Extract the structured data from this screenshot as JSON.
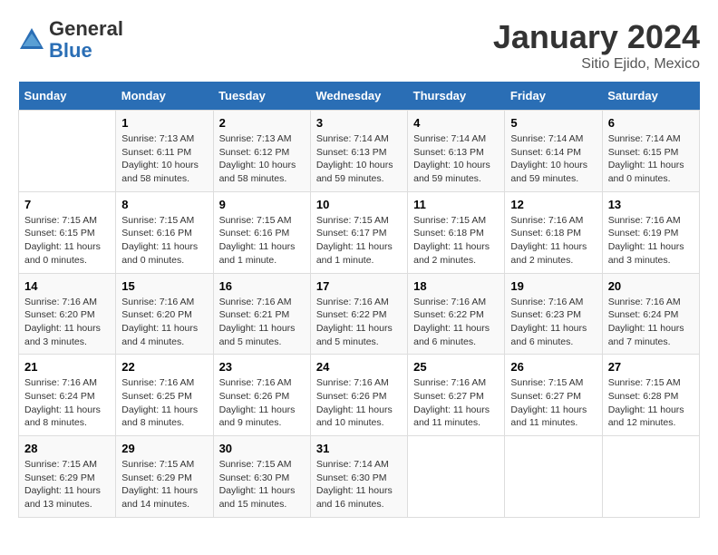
{
  "logo": {
    "general": "General",
    "blue": "Blue"
  },
  "title": "January 2024",
  "location": "Sitio Ejido, Mexico",
  "weekdays": [
    "Sunday",
    "Monday",
    "Tuesday",
    "Wednesday",
    "Thursday",
    "Friday",
    "Saturday"
  ],
  "weeks": [
    [
      {
        "day": "",
        "sunrise": "",
        "sunset": "",
        "daylight": ""
      },
      {
        "day": "1",
        "sunrise": "7:13 AM",
        "sunset": "6:11 PM",
        "daylight": "10 hours and 58 minutes."
      },
      {
        "day": "2",
        "sunrise": "7:13 AM",
        "sunset": "6:12 PM",
        "daylight": "10 hours and 58 minutes."
      },
      {
        "day": "3",
        "sunrise": "7:14 AM",
        "sunset": "6:13 PM",
        "daylight": "10 hours and 59 minutes."
      },
      {
        "day": "4",
        "sunrise": "7:14 AM",
        "sunset": "6:13 PM",
        "daylight": "10 hours and 59 minutes."
      },
      {
        "day": "5",
        "sunrise": "7:14 AM",
        "sunset": "6:14 PM",
        "daylight": "10 hours and 59 minutes."
      },
      {
        "day": "6",
        "sunrise": "7:14 AM",
        "sunset": "6:15 PM",
        "daylight": "11 hours and 0 minutes."
      }
    ],
    [
      {
        "day": "7",
        "sunrise": "7:15 AM",
        "sunset": "6:15 PM",
        "daylight": "11 hours and 0 minutes."
      },
      {
        "day": "8",
        "sunrise": "7:15 AM",
        "sunset": "6:16 PM",
        "daylight": "11 hours and 0 minutes."
      },
      {
        "day": "9",
        "sunrise": "7:15 AM",
        "sunset": "6:16 PM",
        "daylight": "11 hours and 1 minute."
      },
      {
        "day": "10",
        "sunrise": "7:15 AM",
        "sunset": "6:17 PM",
        "daylight": "11 hours and 1 minute."
      },
      {
        "day": "11",
        "sunrise": "7:15 AM",
        "sunset": "6:18 PM",
        "daylight": "11 hours and 2 minutes."
      },
      {
        "day": "12",
        "sunrise": "7:16 AM",
        "sunset": "6:18 PM",
        "daylight": "11 hours and 2 minutes."
      },
      {
        "day": "13",
        "sunrise": "7:16 AM",
        "sunset": "6:19 PM",
        "daylight": "11 hours and 3 minutes."
      }
    ],
    [
      {
        "day": "14",
        "sunrise": "7:16 AM",
        "sunset": "6:20 PM",
        "daylight": "11 hours and 3 minutes."
      },
      {
        "day": "15",
        "sunrise": "7:16 AM",
        "sunset": "6:20 PM",
        "daylight": "11 hours and 4 minutes."
      },
      {
        "day": "16",
        "sunrise": "7:16 AM",
        "sunset": "6:21 PM",
        "daylight": "11 hours and 5 minutes."
      },
      {
        "day": "17",
        "sunrise": "7:16 AM",
        "sunset": "6:22 PM",
        "daylight": "11 hours and 5 minutes."
      },
      {
        "day": "18",
        "sunrise": "7:16 AM",
        "sunset": "6:22 PM",
        "daylight": "11 hours and 6 minutes."
      },
      {
        "day": "19",
        "sunrise": "7:16 AM",
        "sunset": "6:23 PM",
        "daylight": "11 hours and 6 minutes."
      },
      {
        "day": "20",
        "sunrise": "7:16 AM",
        "sunset": "6:24 PM",
        "daylight": "11 hours and 7 minutes."
      }
    ],
    [
      {
        "day": "21",
        "sunrise": "7:16 AM",
        "sunset": "6:24 PM",
        "daylight": "11 hours and 8 minutes."
      },
      {
        "day": "22",
        "sunrise": "7:16 AM",
        "sunset": "6:25 PM",
        "daylight": "11 hours and 8 minutes."
      },
      {
        "day": "23",
        "sunrise": "7:16 AM",
        "sunset": "6:26 PM",
        "daylight": "11 hours and 9 minutes."
      },
      {
        "day": "24",
        "sunrise": "7:16 AM",
        "sunset": "6:26 PM",
        "daylight": "11 hours and 10 minutes."
      },
      {
        "day": "25",
        "sunrise": "7:16 AM",
        "sunset": "6:27 PM",
        "daylight": "11 hours and 11 minutes."
      },
      {
        "day": "26",
        "sunrise": "7:15 AM",
        "sunset": "6:27 PM",
        "daylight": "11 hours and 11 minutes."
      },
      {
        "day": "27",
        "sunrise": "7:15 AM",
        "sunset": "6:28 PM",
        "daylight": "11 hours and 12 minutes."
      }
    ],
    [
      {
        "day": "28",
        "sunrise": "7:15 AM",
        "sunset": "6:29 PM",
        "daylight": "11 hours and 13 minutes."
      },
      {
        "day": "29",
        "sunrise": "7:15 AM",
        "sunset": "6:29 PM",
        "daylight": "11 hours and 14 minutes."
      },
      {
        "day": "30",
        "sunrise": "7:15 AM",
        "sunset": "6:30 PM",
        "daylight": "11 hours and 15 minutes."
      },
      {
        "day": "31",
        "sunrise": "7:14 AM",
        "sunset": "6:30 PM",
        "daylight": "11 hours and 16 minutes."
      },
      {
        "day": "",
        "sunrise": "",
        "sunset": "",
        "daylight": ""
      },
      {
        "day": "",
        "sunrise": "",
        "sunset": "",
        "daylight": ""
      },
      {
        "day": "",
        "sunrise": "",
        "sunset": "",
        "daylight": ""
      }
    ]
  ]
}
